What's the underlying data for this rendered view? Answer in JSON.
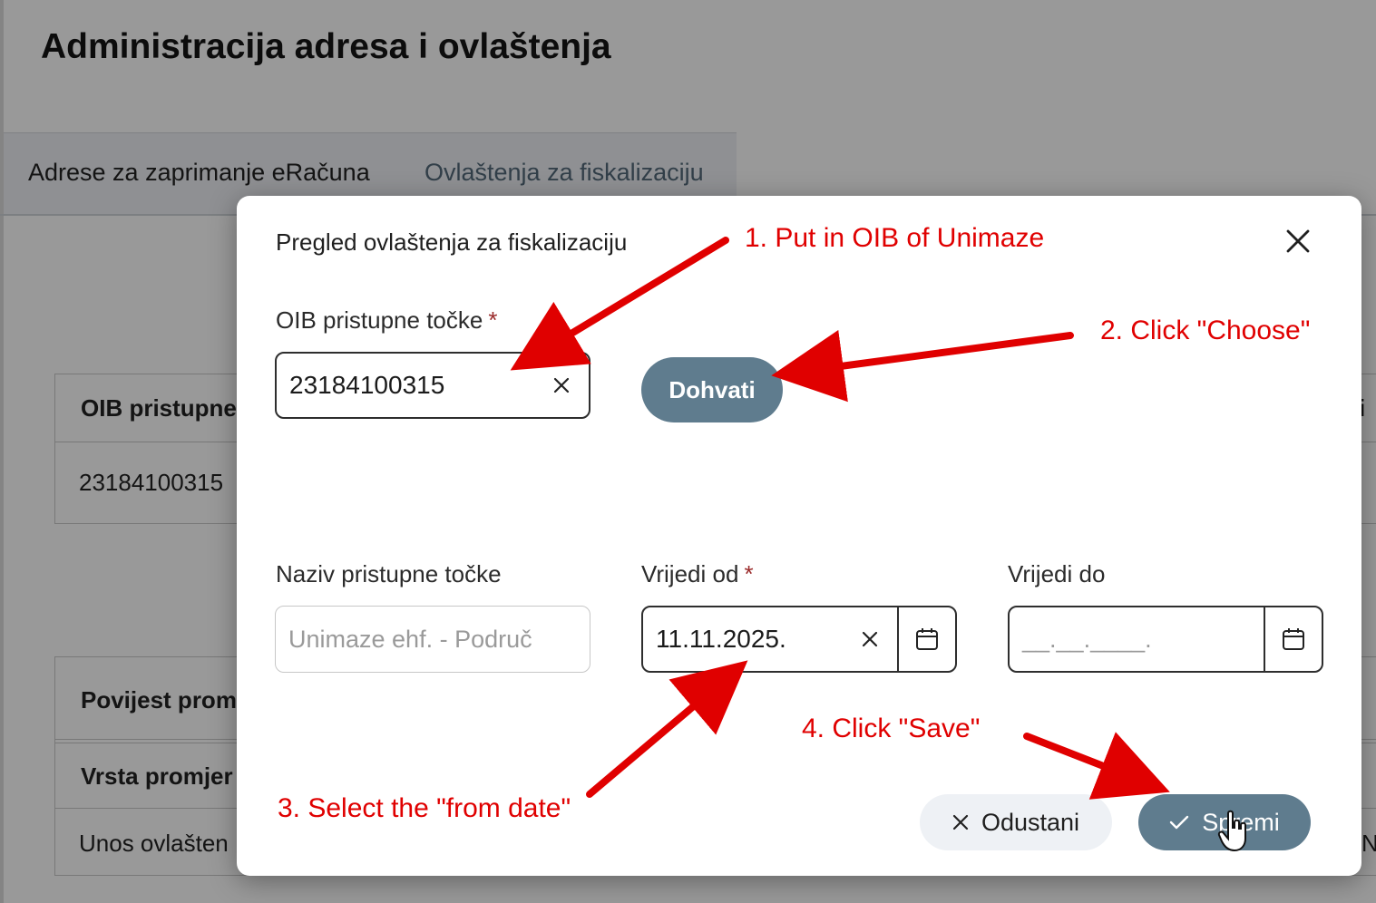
{
  "page": {
    "title": "Administracija adresa i ovlaštenja",
    "tabs": [
      {
        "label": "Adrese za zaprimanje eRačuna"
      },
      {
        "label": "Ovlaštenja za fiskalizaciju"
      }
    ],
    "background_table_1": {
      "header": "OIB pristupne",
      "row_value": "23184100315",
      "right_header_fragment": "i"
    },
    "background_table_2": {
      "section_title": "Povijest prom",
      "header": "Vrsta promjer",
      "row_value": "Unos ovlašten",
      "right_fragment": "N"
    }
  },
  "dialog": {
    "title": "Pregled ovlaštenja za fiskalizaciju",
    "oib_field": {
      "label": "OIB pristupne točke",
      "required_mark": "*",
      "value": "23184100315"
    },
    "fetch_button": {
      "label": "Dohvati"
    },
    "name_field": {
      "label": "Naziv pristupne točke",
      "value": "Unimaze ehf. - Područ"
    },
    "valid_from": {
      "label": "Vrijedi od",
      "required_mark": "*",
      "value": "11.11.2025."
    },
    "valid_to": {
      "label": "Vrijedi do",
      "placeholder": "__.__.____."
    },
    "cancel_button": {
      "label": "Odustani"
    },
    "save_button": {
      "label": "Spremi"
    }
  },
  "annotations": [
    {
      "text": "1. Put in OIB of Unimaze"
    },
    {
      "text": "2. Click \"Choose\""
    },
    {
      "text": "3. Select the \"from date\""
    },
    {
      "text": "4. Click \"Save\""
    }
  ],
  "colors": {
    "accent": "#5f7c8e",
    "annotation": "#e00000",
    "required": "#9a2a2a"
  }
}
